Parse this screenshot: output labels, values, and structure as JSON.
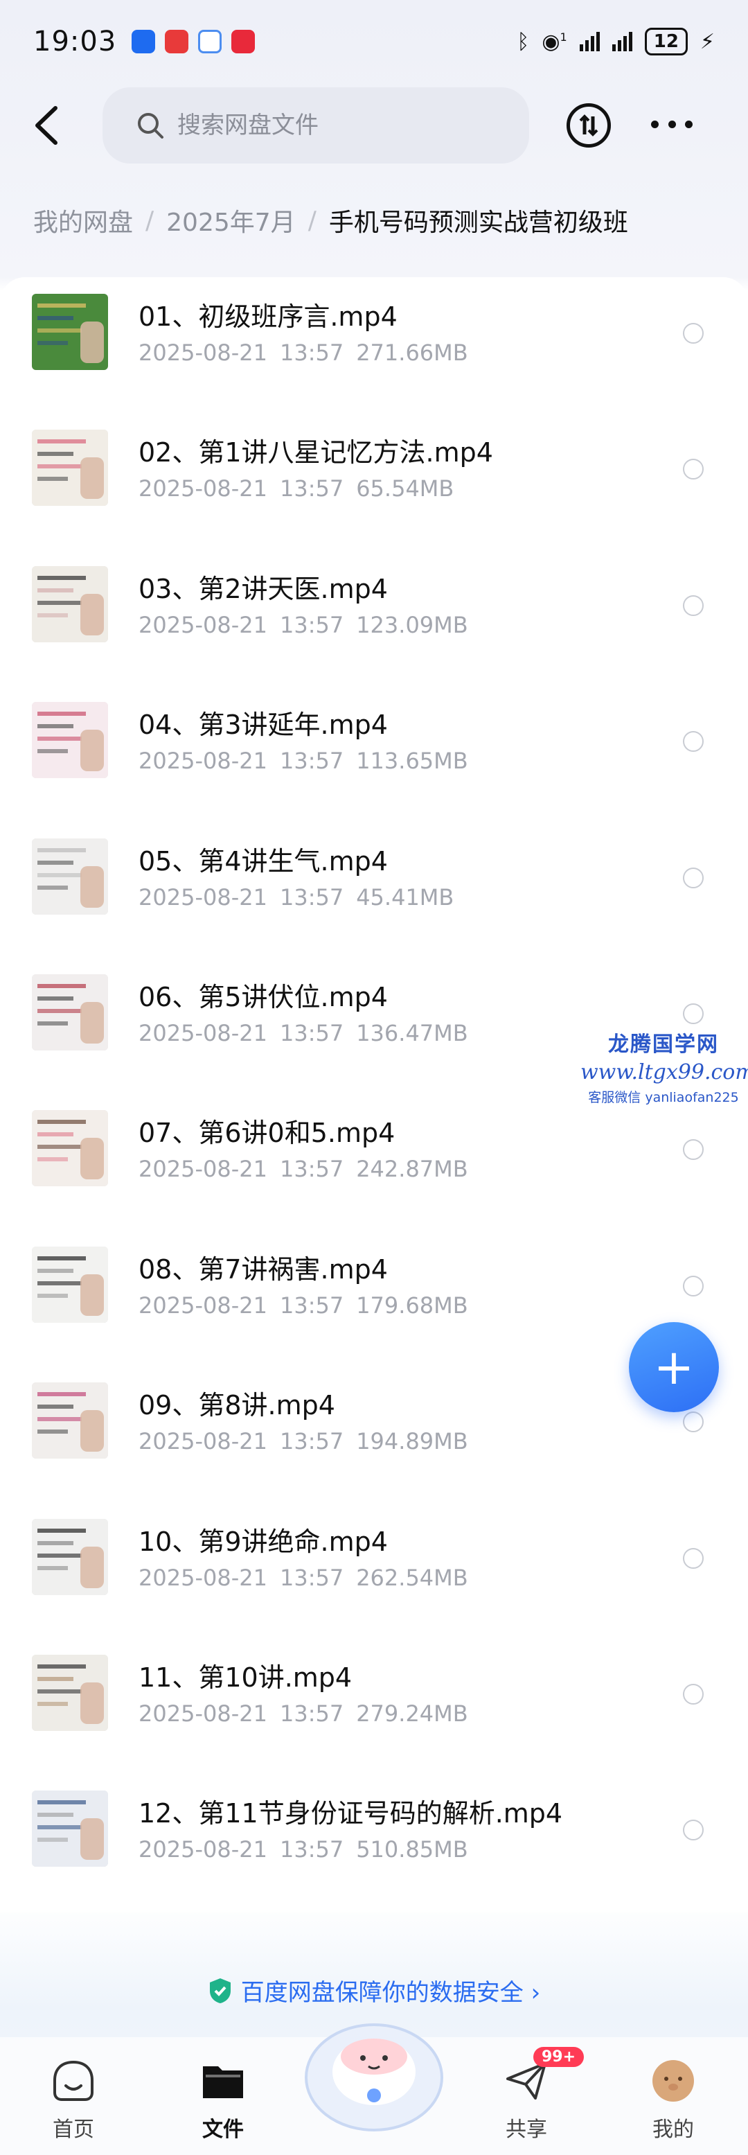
{
  "status_bar": {
    "time": "19:03",
    "battery": "12",
    "signal_note": "1"
  },
  "header": {
    "search_placeholder": "搜索网盘文件"
  },
  "breadcrumb": [
    "我的网盘",
    "2025年7月",
    "手机号码预测实战营初级班"
  ],
  "files": [
    {
      "name": "01、初级班序言.mp4",
      "date": "2025-08-21",
      "time": "13:57",
      "size": "271.66MB"
    },
    {
      "name": "02、第1讲八星记忆方法.mp4",
      "date": "2025-08-21",
      "time": "13:57",
      "size": "65.54MB"
    },
    {
      "name": "03、第2讲天医.mp4",
      "date": "2025-08-21",
      "time": "13:57",
      "size": "123.09MB"
    },
    {
      "name": "04、第3讲延年.mp4",
      "date": "2025-08-21",
      "time": "13:57",
      "size": "113.65MB"
    },
    {
      "name": "05、第4讲生气.mp4",
      "date": "2025-08-21",
      "time": "13:57",
      "size": "45.41MB"
    },
    {
      "name": "06、第5讲伏位.mp4",
      "date": "2025-08-21",
      "time": "13:57",
      "size": "136.47MB"
    },
    {
      "name": "07、第6讲0和5.mp4",
      "date": "2025-08-21",
      "time": "13:57",
      "size": "242.87MB"
    },
    {
      "name": "08、第7讲祸害.mp4",
      "date": "2025-08-21",
      "time": "13:57",
      "size": "179.68MB"
    },
    {
      "name": "09、第8讲.mp4",
      "date": "2025-08-21",
      "time": "13:57",
      "size": "194.89MB"
    },
    {
      "name": "10、第9讲绝命.mp4",
      "date": "2025-08-21",
      "time": "13:57",
      "size": "262.54MB"
    },
    {
      "name": "11、第10讲.mp4",
      "date": "2025-08-21",
      "time": "13:57",
      "size": "279.24MB"
    },
    {
      "name": "12、第11节身份证号码的解析.mp4",
      "date": "2025-08-21",
      "time": "13:57",
      "size": "510.85MB"
    }
  ],
  "watermark": {
    "line1": "龙腾国学网",
    "line2": "www.ltgx99.com",
    "line3": "客服微信 yanliaofan225"
  },
  "security_banner": "百度网盘保障你的数据安全 ›",
  "bottom_nav": {
    "home": "首页",
    "files": "文件",
    "share": "共享",
    "share_badge": "99+",
    "me": "我的"
  },
  "colors": {
    "accent": "#2a6cf0",
    "badge": "#ff3b55",
    "watermark": "#2a57c8"
  }
}
